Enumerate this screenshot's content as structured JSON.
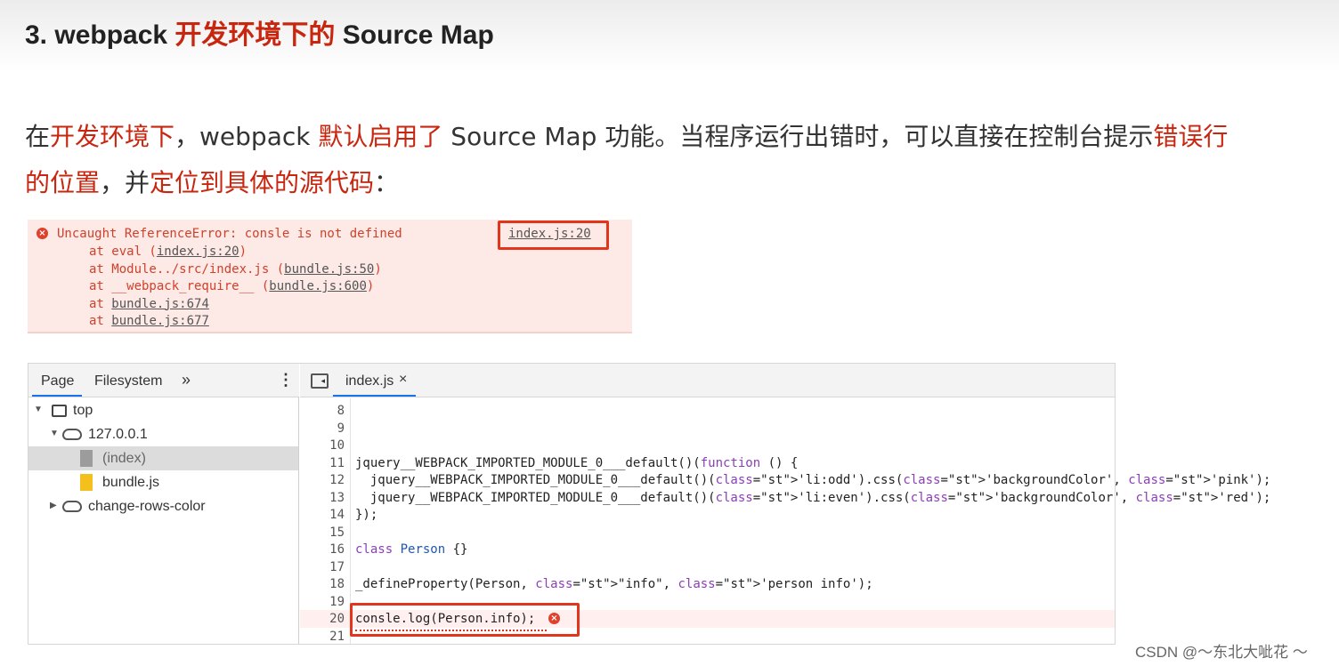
{
  "heading": {
    "prefix": "3. webpack ",
    "highlight": "开发环境下的",
    "suffix": " Source Map"
  },
  "paragraph": {
    "parts": [
      {
        "text": "在",
        "red": false
      },
      {
        "text": "开发环境下",
        "red": true
      },
      {
        "text": "，webpack ",
        "red": false
      },
      {
        "text": "默认启用了",
        "red": true
      },
      {
        "text": " Source Map 功能。当程序运行出错时，可以直接在控制台提示",
        "red": false
      },
      {
        "text": "错误行",
        "red": true
      },
      {
        "text": "的位置",
        "red": true
      },
      {
        "text": "，并",
        "red": false
      },
      {
        "text": "定位到具体的源代码",
        "red": true
      },
      {
        "text": "：",
        "red": false
      }
    ]
  },
  "console_error": {
    "icon": "error-icon",
    "message": "Uncaught ReferenceError: consle is not defined",
    "source_link": "index.js:20",
    "stack": [
      {
        "prefix": "at eval (",
        "link": "index.js:20",
        "suffix": ")"
      },
      {
        "prefix": "at Module../src/index.js (",
        "link": "bundle.js:50",
        "suffix": ")"
      },
      {
        "prefix": "at __webpack_require__ (",
        "link": "bundle.js:600",
        "suffix": ")"
      },
      {
        "prefix": "at ",
        "link": "bundle.js:674",
        "suffix": ""
      },
      {
        "prefix": "at ",
        "link": "bundle.js:677",
        "suffix": ""
      }
    ]
  },
  "devtools": {
    "left_tabs": {
      "page": "Page",
      "filesystem": "Filesystem",
      "more": "»",
      "menu": "⋮"
    },
    "tree": [
      {
        "label": "top",
        "icon": "window-icon",
        "arrow": "▼"
      },
      {
        "label": "127.0.0.1",
        "icon": "cloud-icon",
        "arrow": "▼"
      },
      {
        "label": "(index)",
        "icon": "file-gray-icon",
        "arrow": ""
      },
      {
        "label": "bundle.js",
        "icon": "file-yellow-icon",
        "arrow": ""
      },
      {
        "label": "change-rows-color",
        "icon": "cloud-icon",
        "arrow": "▶"
      }
    ],
    "file_tab": {
      "name": "index.js",
      "close": "×"
    },
    "code_lines": [
      {
        "num": "8",
        "text": ""
      },
      {
        "num": "9",
        "text": ""
      },
      {
        "num": "10",
        "text": ""
      },
      {
        "num": "11",
        "text": "jquery__WEBPACK_IMPORTED_MODULE_0___default()(function () {"
      },
      {
        "num": "12",
        "text": "  jquery__WEBPACK_IMPORTED_MODULE_0___default()('li:odd').css('backgroundColor', 'pink');"
      },
      {
        "num": "13",
        "text": "  jquery__WEBPACK_IMPORTED_MODULE_0___default()('li:even').css('backgroundColor', 'red');"
      },
      {
        "num": "14",
        "text": "});"
      },
      {
        "num": "15",
        "text": ""
      },
      {
        "num": "16",
        "text": "class Person {}"
      },
      {
        "num": "17",
        "text": ""
      },
      {
        "num": "18",
        "text": "_defineProperty(Person, \"info\", 'person info');"
      },
      {
        "num": "19",
        "text": ""
      },
      {
        "num": "20",
        "text": "consle.log(Person.info);"
      },
      {
        "num": "21",
        "text": ""
      }
    ]
  },
  "watermark": "CSDN @～东北大呲花 ～"
}
